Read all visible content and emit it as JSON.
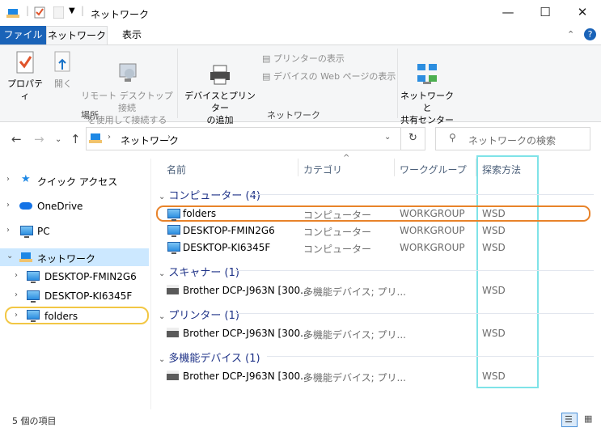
{
  "window": {
    "title": "ネットワーク",
    "controls": [
      "—",
      "☐",
      "✕"
    ]
  },
  "ribbon_tabs": [
    "ファイル",
    "ネットワーク",
    "表示"
  ],
  "ribbon": {
    "properties": "プロパティ",
    "open": "開く",
    "remote_desktop": "リモート デスクトップ接続\nを使用して接続する",
    "group_location": "場所",
    "devices_printers": "デバイスとプリンター\nの追加",
    "view_printers": "プリンターの表示",
    "view_device_web": "デバイスの Web ページの表示",
    "group_network": "ネットワーク",
    "network_sharing": "ネットワークと\n共有センター"
  },
  "address": {
    "path": "ネットワーク",
    "search_placeholder": "ネットワークの検索"
  },
  "nav": [
    {
      "label": "クイック アクセス",
      "icon": "star-icon"
    },
    {
      "label": "OneDrive",
      "icon": "cloud-icon"
    },
    {
      "label": "PC",
      "icon": "pc-icon"
    },
    {
      "label": "ネットワーク",
      "icon": "network-icon",
      "selected": true
    },
    {
      "label": "DESKTOP-FMIN2G6",
      "icon": "pc-icon"
    },
    {
      "label": "DESKTOP-KI6345F",
      "icon": "pc-icon"
    },
    {
      "label": "folders",
      "icon": "pc-icon"
    }
  ],
  "columns": [
    "名前",
    "カテゴリ",
    "ワークグループ",
    "探索方法"
  ],
  "groups": [
    {
      "title": "コンピューター (4)",
      "rows": [
        {
          "name": "folders",
          "category": "コンピューター",
          "workgroup": "WORKGROUP",
          "discovery": "WSD"
        },
        {
          "name": "DESKTOP-FMIN2G6",
          "category": "コンピューター",
          "workgroup": "WORKGROUP",
          "discovery": "WSD"
        },
        {
          "name": "DESKTOP-KI6345F",
          "category": "コンピューター",
          "workgroup": "WORKGROUP",
          "discovery": "WSD"
        }
      ]
    },
    {
      "title": "スキャナー (1)",
      "rows": [
        {
          "name": "Brother DCP-J963N [300...",
          "category": "多機能デバイス; プリ...",
          "workgroup": "",
          "discovery": "WSD"
        }
      ]
    },
    {
      "title": "プリンター (1)",
      "rows": [
        {
          "name": "Brother DCP-J963N [300...",
          "category": "多機能デバイス; プリ...",
          "workgroup": "",
          "discovery": "WSD"
        }
      ]
    },
    {
      "title": "多機能デバイス (1)",
      "rows": [
        {
          "name": "Brother DCP-J963N [300...",
          "category": "多機能デバイス; プリ...",
          "workgroup": "",
          "discovery": "WSD"
        }
      ]
    }
  ],
  "status": "5 個の項目",
  "colors": {
    "highlight_orange": "#e8832a",
    "highlight_yellow": "#f2c744",
    "highlight_cyan": "#7fe3e8",
    "selection": "#cce8ff"
  }
}
